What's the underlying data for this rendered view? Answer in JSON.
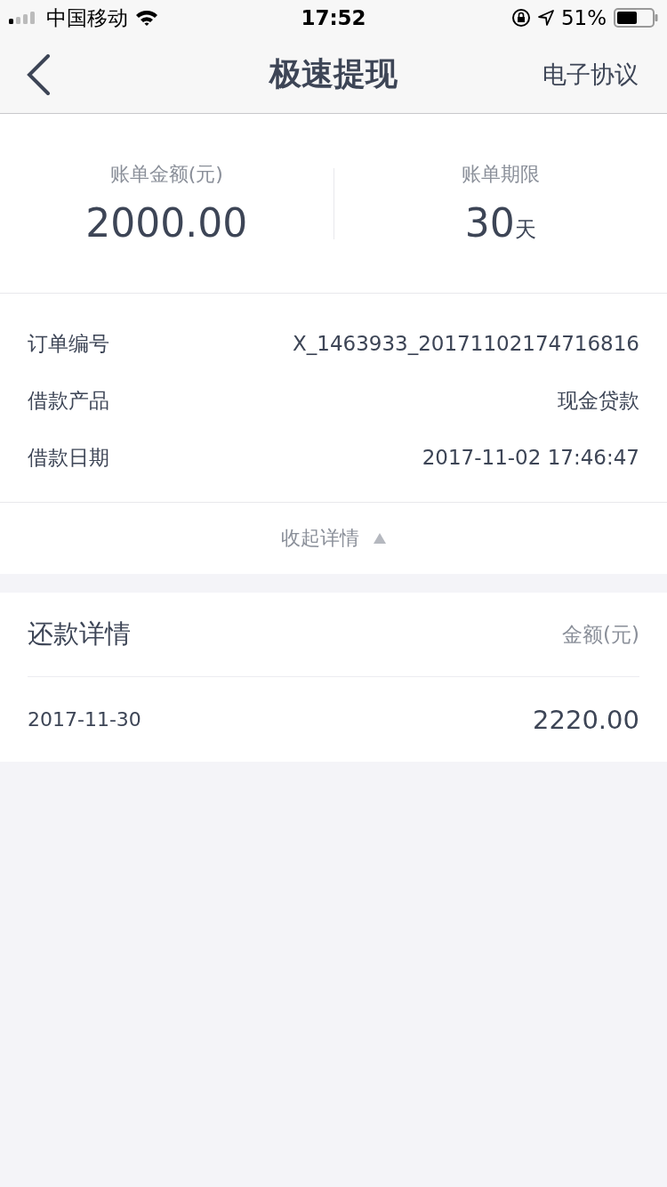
{
  "status_bar": {
    "carrier": "中国移动",
    "time": "17:52",
    "battery": "51%"
  },
  "nav": {
    "title": "极速提现",
    "action": "电子协议"
  },
  "summary": [
    {
      "label": "账单金额(元)",
      "value": "2000.00"
    },
    {
      "label": "账单期限",
      "value": "30",
      "unit": "天"
    }
  ],
  "details": [
    {
      "label": "订单编号",
      "value": "X_1463933_20171102174716816"
    },
    {
      "label": "借款产品",
      "value": "现金贷款"
    },
    {
      "label": "借款日期",
      "value": "2017-11-02 17:46:47"
    }
  ],
  "toggle": {
    "label": "收起详情",
    "expanded": true
  },
  "repayment": {
    "title": "还款详情",
    "column": "金额(元)",
    "rows": [
      {
        "date": "2017-11-30",
        "amount": "2220.00"
      }
    ]
  }
}
